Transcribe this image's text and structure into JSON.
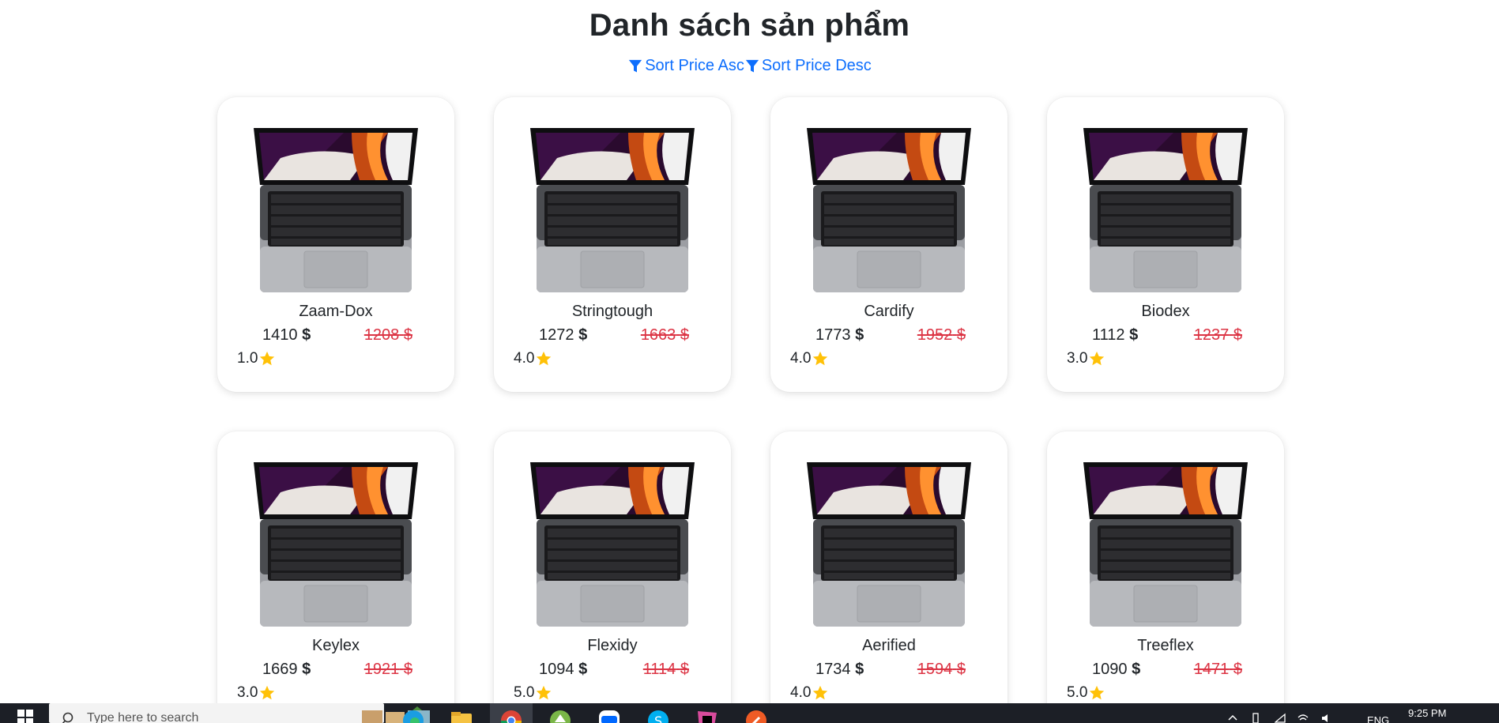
{
  "page": {
    "title": "Danh sách sản phẩm",
    "sort_asc_label": "Sort Price Asc",
    "sort_desc_label": "Sort Price Desc",
    "currency": "$"
  },
  "products": [
    {
      "name": "Zaam-Dox",
      "price": "1410",
      "old_price": "1208",
      "rating": "1.0"
    },
    {
      "name": "Stringtough",
      "price": "1272",
      "old_price": "1663",
      "rating": "4.0"
    },
    {
      "name": "Cardify",
      "price": "1773",
      "old_price": "1952",
      "rating": "4.0"
    },
    {
      "name": "Biodex",
      "price": "1112",
      "old_price": "1237",
      "rating": "3.0"
    },
    {
      "name": "Keylex",
      "price": "1669",
      "old_price": "1921",
      "rating": "3.0"
    },
    {
      "name": "Flexidy",
      "price": "1094",
      "old_price": "1114",
      "rating": "5.0"
    },
    {
      "name": "Aerified",
      "price": "1734",
      "old_price": "1594",
      "rating": "4.0"
    },
    {
      "name": "Treeflex",
      "price": "1090",
      "old_price": "1471",
      "rating": "5.0"
    }
  ],
  "taskbar": {
    "search_placeholder": "Type here to search",
    "time": "9:25 PM",
    "language": "ENG"
  },
  "colors": {
    "link": "#0d6efd",
    "old_price": "#dc3545",
    "star": "#ffc107",
    "taskbar": "#1c1f26"
  },
  "icons": [
    "filter-icon",
    "star-icon",
    "laptop-image",
    "windows-start-icon",
    "search-icon",
    "edge-icon",
    "file-explorer-icon",
    "chrome-icon",
    "zalo-icon",
    "skype-icon"
  ]
}
